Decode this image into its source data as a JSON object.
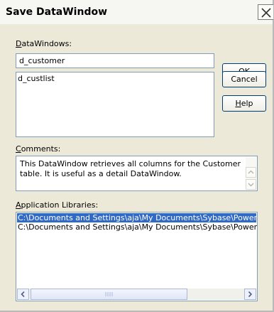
{
  "window": {
    "title": "Save DataWindow"
  },
  "datawindows": {
    "label_pre": "",
    "label_ul": "D",
    "label_post": "ataWindows:",
    "value": "d_customer",
    "items": [
      "d_custlist"
    ]
  },
  "buttons": {
    "ok": "OK",
    "cancel": "Cancel",
    "help_ul": "H",
    "help_rest": "elp"
  },
  "comments": {
    "label_ul": "C",
    "label_post": "omments:",
    "line1": "This DataWindow retrieves all columns for the Customer",
    "line2": "table. It is useful as a detail DataWindow."
  },
  "libraries": {
    "label_ul": "A",
    "label_post": "pplication Libraries:",
    "items": [
      "C:\\Documents and Settings\\aja\\My Documents\\Sybase\\PowerB",
      "C:\\Documents and Settings\\aja\\My Documents\\Sybase\\PowerB"
    ]
  },
  "colors": {
    "selection": "#316ac5",
    "border": "#7f9db9"
  }
}
